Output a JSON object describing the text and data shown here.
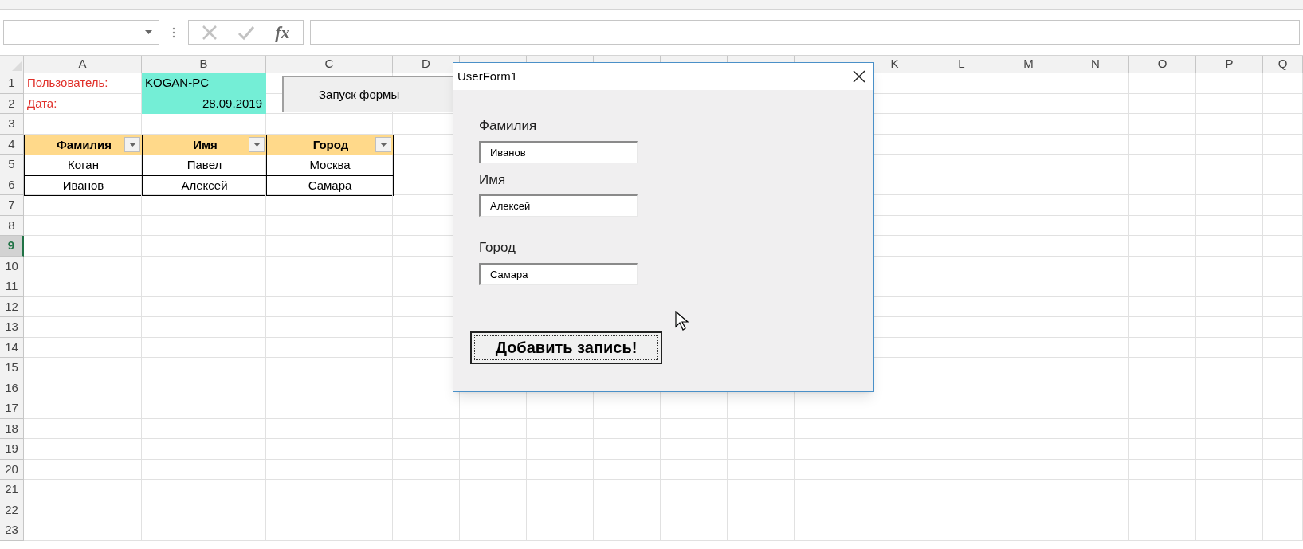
{
  "formula_bar": {
    "function_label": "fx"
  },
  "sheet": {
    "column_headers": [
      {
        "label": "A"
      },
      {
        "label": "B"
      },
      {
        "label": "C"
      },
      {
        "label": "D"
      },
      {
        "label": "K"
      },
      {
        "label": "L"
      },
      {
        "label": "M"
      },
      {
        "label": "N"
      },
      {
        "label": "O"
      },
      {
        "label": "P"
      },
      {
        "label": "Q"
      }
    ],
    "rows": [
      {
        "number": "1",
        "selected": false,
        "cells": [
          {
            "kind": "label",
            "text": "Пользователь:"
          },
          {
            "kind": "highlight",
            "text": "KOGAN-PC"
          }
        ]
      },
      {
        "number": "2",
        "selected": false,
        "cells": [
          {
            "kind": "label",
            "text": "Дата:"
          },
          {
            "kind": "highlight_right",
            "text": "28.09.2019"
          }
        ]
      },
      {
        "number": "3",
        "selected": false,
        "cells": []
      },
      {
        "number": "4",
        "selected": false,
        "cells": [
          {
            "kind": "header",
            "text": "Фамилия"
          },
          {
            "kind": "header",
            "text": "Имя"
          },
          {
            "kind": "header",
            "text": "Город"
          }
        ]
      },
      {
        "number": "5",
        "selected": false,
        "cells": [
          {
            "kind": "data",
            "text": "Коган"
          },
          {
            "kind": "data",
            "text": "Павел"
          },
          {
            "kind": "data",
            "text": "Москва"
          }
        ]
      },
      {
        "number": "6",
        "selected": false,
        "cells": [
          {
            "kind": "data",
            "text": "Иванов"
          },
          {
            "kind": "data",
            "text": "Алексей"
          },
          {
            "kind": "data",
            "text": "Самара"
          }
        ]
      },
      {
        "number": "7",
        "selected": false,
        "cells": []
      },
      {
        "number": "8",
        "selected": false,
        "cells": []
      },
      {
        "number": "9",
        "selected": true,
        "cells": []
      },
      {
        "number": "10",
        "selected": false,
        "cells": []
      },
      {
        "number": "11",
        "selected": false,
        "cells": []
      },
      {
        "number": "12",
        "selected": false,
        "cells": []
      },
      {
        "number": "13",
        "selected": false,
        "cells": []
      },
      {
        "number": "14",
        "selected": false,
        "cells": []
      },
      {
        "number": "15",
        "selected": false,
        "cells": []
      },
      {
        "number": "16",
        "selected": false,
        "cells": []
      },
      {
        "number": "17",
        "selected": false,
        "cells": []
      },
      {
        "number": "18",
        "selected": false,
        "cells": []
      },
      {
        "number": "19",
        "selected": false,
        "cells": []
      },
      {
        "number": "20",
        "selected": false,
        "cells": []
      },
      {
        "number": "21",
        "selected": false,
        "cells": []
      },
      {
        "number": "22",
        "selected": false,
        "cells": []
      },
      {
        "number": "23",
        "selected": false,
        "cells": []
      }
    ],
    "launch_button": {
      "label": "Запуск формы"
    }
  },
  "dialog": {
    "title": "UserForm1",
    "fields": [
      {
        "label": "Фамилия",
        "value": "Иванов"
      },
      {
        "label": "Имя",
        "value": "Алексей"
      },
      {
        "label": "Город",
        "value": "Самара"
      }
    ],
    "submit_button": {
      "label": "Добавить запись!"
    }
  }
}
